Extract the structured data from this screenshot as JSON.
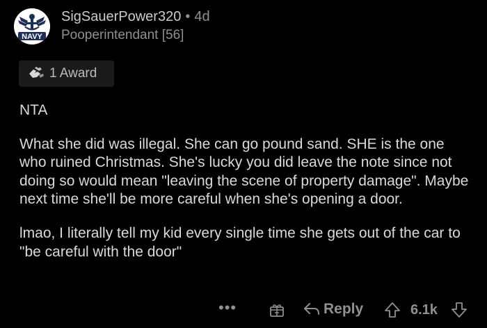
{
  "comment": {
    "username": "SigSauerPower320",
    "separator": "•",
    "age": "4d",
    "flair": "Pooperintendant [56]",
    "avatar_text": "NAVY",
    "award_label": "1 Award",
    "body": [
      "NTA",
      "What she did was illegal. She can go pound sand. SHE is the one who ruined Christmas. She's lucky you did leave the note since not doing so would mean \"leaving the scene of property damage\". Maybe next time she'll be more careful when she's opening a door.",
      "lmao, I literally tell my kid every single time she gets out of the car to \"be careful with the door\""
    ]
  },
  "actions": {
    "more_label": "•••",
    "reply_label": "Reply",
    "score": "6.1k"
  },
  "icons": {
    "more": "more-options-icon",
    "gift": "gift-award-icon",
    "reply": "reply-arrow-icon",
    "upvote": "upvote-arrow-icon",
    "downvote": "downvote-arrow-icon",
    "award": "award-hands-icon"
  },
  "colors": {
    "background": "#000000",
    "text": "#d7dadc",
    "muted": "#8e9193",
    "navy": "#1d2e5a"
  }
}
